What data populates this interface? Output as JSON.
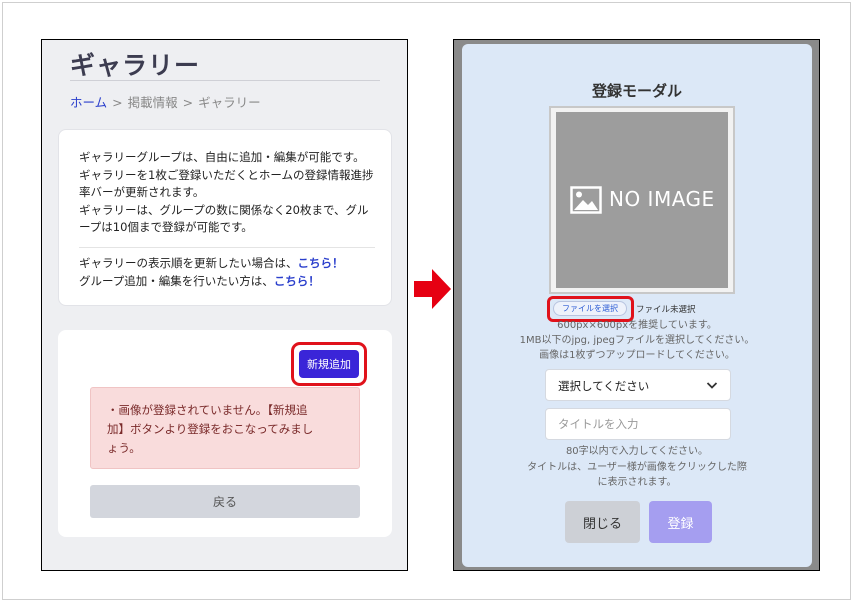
{
  "left": {
    "page_title": "ギャラリー",
    "breadcrumb": {
      "home": "ホーム",
      "separator": ">",
      "section": "掲載情報",
      "current": "ギャラリー"
    },
    "info": {
      "paragraph": [
        "ギャラリーグループは、自由に追加・編集が可能です。",
        "ギャラリーを1枚ご登録いただくとホームの登録情報進捗",
        "率バーが更新されます。",
        "ギャラリーは、グループの数に関係なく20枚まで、グル",
        "ープは10個まで登録が可能です。"
      ],
      "link_lines": [
        {
          "text": "ギャラリーの表示順を更新したい場合は、",
          "link": "こちら！"
        },
        {
          "text": "グループ追加・編集を行いたい方は、",
          "link": "こちら！"
        }
      ]
    },
    "new_button_label": "新規追加",
    "alert_lines": [
      "・画像が登録されていません。【新規追",
      "加】ボタンより登録をおこなってみまし",
      "ょう。"
    ],
    "back_button_label": "戻る"
  },
  "right": {
    "modal_title": "登録モーダル",
    "no_image_text": "NO IMAGE",
    "file_button_label": "ファイルを選択",
    "file_status": "ファイル未選択",
    "image_help": [
      "600px×600pxを推奨しています。",
      "1MB以下のjpg, jpegファイルを選択してください。",
      "画像は1枚ずつアップロードしてください。"
    ],
    "select_label": "選択してください",
    "title_placeholder": "タイトルを入力",
    "title_help": [
      "80字以内で入力してください。",
      "タイトルは、ユーザー様が画像をクリックした際",
      "に表示されます。"
    ],
    "close_button_label": "閉じる",
    "register_button_label": "登録"
  },
  "colors": {
    "accent": "#3a25d8",
    "highlight": "#e0121b",
    "link": "#2b3fcc",
    "alert_bg": "#f9dcdc",
    "modal_bg": "#dce8f7",
    "register_disabled": "#a59ef0"
  },
  "icons": {
    "arrow": "arrow-right-icon",
    "image_placeholder": "image-icon",
    "select": "chevron-down-icon"
  }
}
